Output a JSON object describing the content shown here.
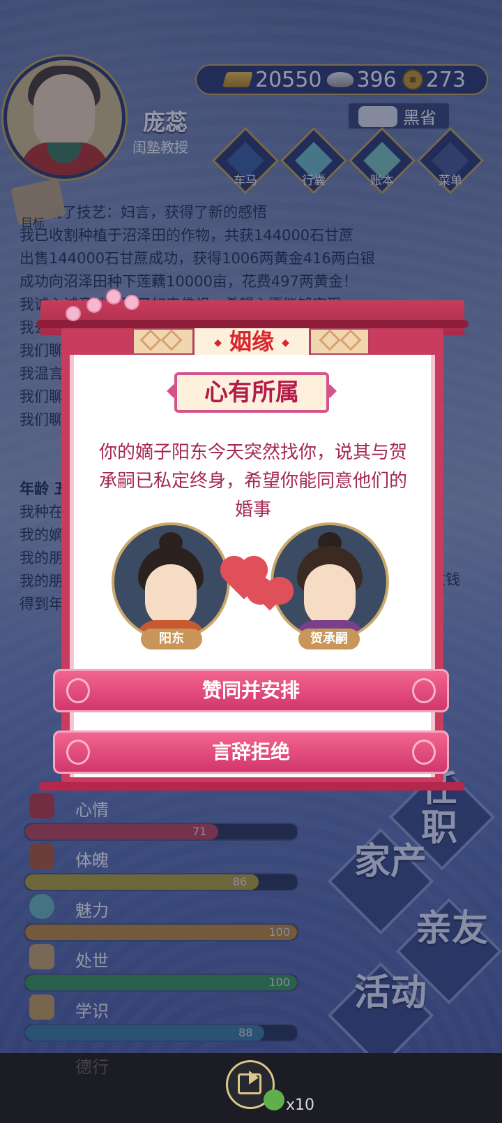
{
  "player": {
    "name": "庞蕊",
    "title": "闺塾教授"
  },
  "currency": {
    "gold": "20550",
    "silver": "396",
    "coins": "273"
  },
  "weather": "黑省",
  "top_menu": [
    {
      "label": "车马",
      "icon": "carriage-icon"
    },
    {
      "label": "行囊",
      "icon": "bag-icon"
    },
    {
      "label": "账本",
      "icon": "ledger-icon"
    },
    {
      "label": "菜单",
      "icon": "more-icon"
    }
  ],
  "goal_label": "目标",
  "log": [
    "成了技艺：妇言，获得了新的感悟",
    "我已收割种植于沼泽田的作物，共获144000石甘蔗",
    "出售144000石甘蔗成功，获得1006两黄金416两白银",
    "成功向沼泽田种下莲藕10000亩，花费497两黄金！",
    "我诚心诚意地参拜了如来佛祖，希望心愿能够实现",
    "我去",
    "我们聊",
    "我温言",
    "我们聊",
    "我们聊"
  ],
  "log2": [
    "年龄 五",
    "我种在",
    "我的嫡",
    "我的朋",
    "我的朋",
    "得到年"
  ],
  "log2_tail": "文钱",
  "stats": [
    {
      "label": "心情",
      "value": 71,
      "color": "#c2455a",
      "icon": "flower-icon"
    },
    {
      "label": "体魄",
      "value": 86,
      "color": "#b6a53c",
      "icon": "dumbbell-icon"
    },
    {
      "label": "魅力",
      "value": 100,
      "color": "#c48a3a",
      "icon": "mirror-icon"
    },
    {
      "label": "处世",
      "value": 100,
      "color": "#3b9a5a",
      "icon": "boat-icon"
    },
    {
      "label": "学识",
      "value": 88,
      "color": "#3c7fa0",
      "icon": "books-icon"
    }
  ],
  "faded_stat_label": "德行",
  "actions": {
    "job": "任职",
    "property": "家产",
    "relatives": "亲友",
    "activity": "活动"
  },
  "modal": {
    "header": "姻缘",
    "subtitle": "心有所属",
    "message": "你的嫡子阳东今天突然找你，说其与贺承嗣已私定终身，希望你能同意他们的婚事",
    "person_left": "阳东",
    "person_right": "贺承嗣",
    "approve_button": "赞同并安排",
    "reject_button": "言辞拒绝"
  },
  "bottom": {
    "multiplier": "x10"
  }
}
